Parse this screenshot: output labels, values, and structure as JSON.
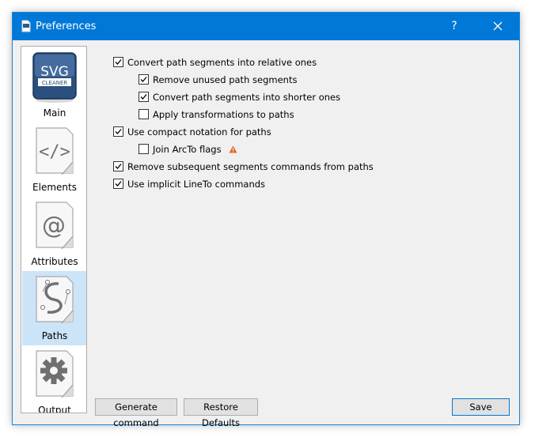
{
  "window": {
    "title": "Preferences",
    "help_label": "?"
  },
  "sidebar": {
    "items": [
      {
        "label": "Main",
        "icon": "svg-cleaner-logo-icon",
        "logo_text_top": "SVG",
        "logo_text_bottom": "CLEANER",
        "selected": false
      },
      {
        "label": "Elements",
        "icon": "code-tag-icon",
        "glyph": "</>",
        "selected": false
      },
      {
        "label": "Attributes",
        "icon": "at-sign-icon",
        "glyph": "@",
        "selected": false
      },
      {
        "label": "Paths",
        "icon": "bezier-path-icon",
        "selected": true
      },
      {
        "label": "Output",
        "icon": "gear-icon",
        "selected": false
      }
    ]
  },
  "options": [
    {
      "label": "Convert path segments into relative ones",
      "checked": true,
      "indent": 0
    },
    {
      "label": "Remove unused path segments",
      "checked": true,
      "indent": 1
    },
    {
      "label": "Convert path segments into shorter ones",
      "checked": true,
      "indent": 1
    },
    {
      "label": "Apply transformations to paths",
      "checked": false,
      "indent": 1
    },
    {
      "label": "Use compact notation for paths",
      "checked": true,
      "indent": 0
    },
    {
      "label": "Join ArcTo flags",
      "checked": false,
      "indent": 1,
      "warning": true
    },
    {
      "label": "Remove subsequent segments commands from paths",
      "checked": true,
      "indent": 0
    },
    {
      "label": "Use implicit LineTo commands",
      "checked": true,
      "indent": 0
    }
  ],
  "buttons": {
    "generate": "Generate command",
    "restore": "Restore Defaults",
    "save": "Save"
  },
  "colors": {
    "titlebar": "#0078d7",
    "selection": "#cce4f7",
    "warning": "#e8661c"
  }
}
